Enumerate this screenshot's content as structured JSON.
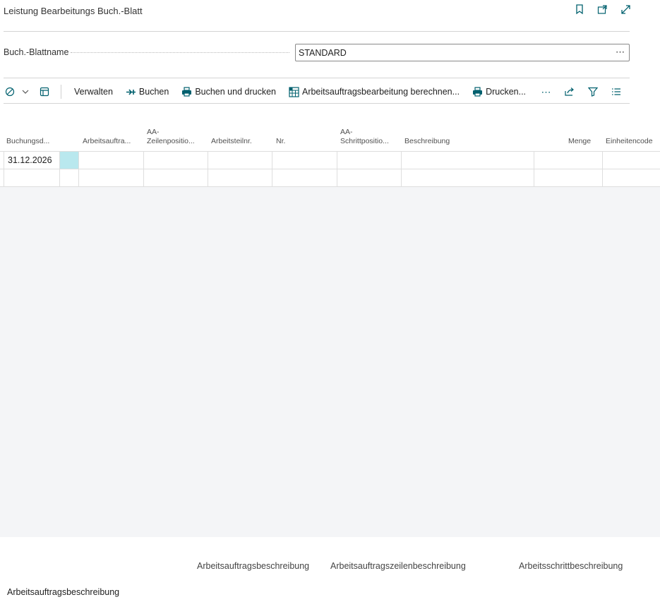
{
  "page": {
    "title": "Leistung Bearbeitungs Buch.-Blatt",
    "title_actions": [
      "bookmark-icon",
      "open-new-window-icon",
      "expand-icon"
    ]
  },
  "batch": {
    "label": "Buch.-Blattname",
    "value": "STANDARD",
    "ellipsis": "⋯"
  },
  "toolbar": {
    "verwalten": "Verwalten",
    "buchen": "Buchen",
    "buchen_drucken": "Buchen und drucken",
    "berechnen": "Arbeitsauftragsbearbeitung berechnen...",
    "drucken": "Drucken...",
    "more": "⋯"
  },
  "grid": {
    "columns": [
      "Buchungsd...",
      "",
      "Arbeitsauftra...",
      "AA-\nZeilenpositio...",
      "Arbeitsteilnr.",
      "Nr.",
      "AA-\nSchrittpositio...",
      "Beschreibung",
      "",
      "Menge",
      "Einheitencode"
    ],
    "rows": [
      {
        "posting_date": "31.12.2026"
      },
      {
        "posting_date": ""
      }
    ]
  },
  "footer": {
    "link1": "Arbeitsauftragsbeschreibung",
    "link2": "Arbeitsauftragszeilenbeschreibung",
    "link3": "Arbeitsschrittbeschreibung",
    "bottom_label": "Arbeitsauftragsbeschreibung"
  },
  "colors": {
    "accent": "#00606e",
    "selected_cell": "#b9e8ee",
    "empty_area": "#f4f5f7"
  }
}
